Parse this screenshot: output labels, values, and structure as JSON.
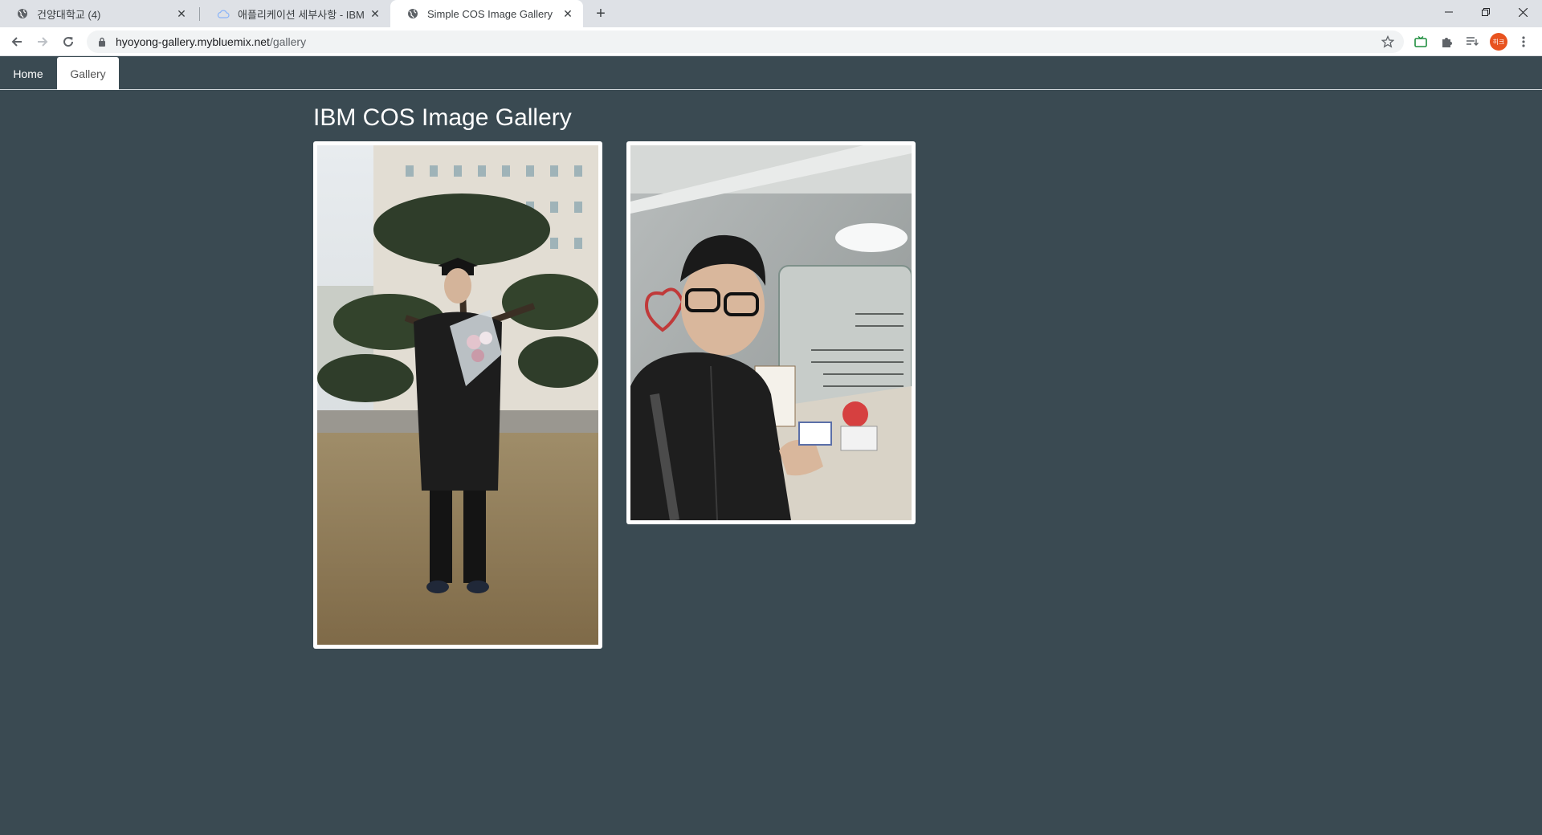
{
  "browser": {
    "tabs": [
      {
        "title": "건양대학교 (4)",
        "icon": "globe-icon",
        "active": false
      },
      {
        "title": "애플리케이션 세부사항 - IBM Cl",
        "icon": "cloud-icon",
        "active": false
      },
      {
        "title": "Simple COS Image Gallery",
        "icon": "globe-icon",
        "active": true
      }
    ],
    "url_host": "hyoyong-gallery.mybluemix.net",
    "url_path": "/gallery",
    "profile_initials": "히크"
  },
  "nav": {
    "home": "Home",
    "gallery": "Gallery"
  },
  "page": {
    "title": "IBM COS Image Gallery"
  },
  "gallery": {
    "images": [
      {
        "alt": "graduation photo"
      },
      {
        "alt": "selfie photo"
      }
    ]
  },
  "colors": {
    "background": "#3a4a52",
    "nav_active_bg": "#ffffff",
    "profile": "#e8531f"
  }
}
